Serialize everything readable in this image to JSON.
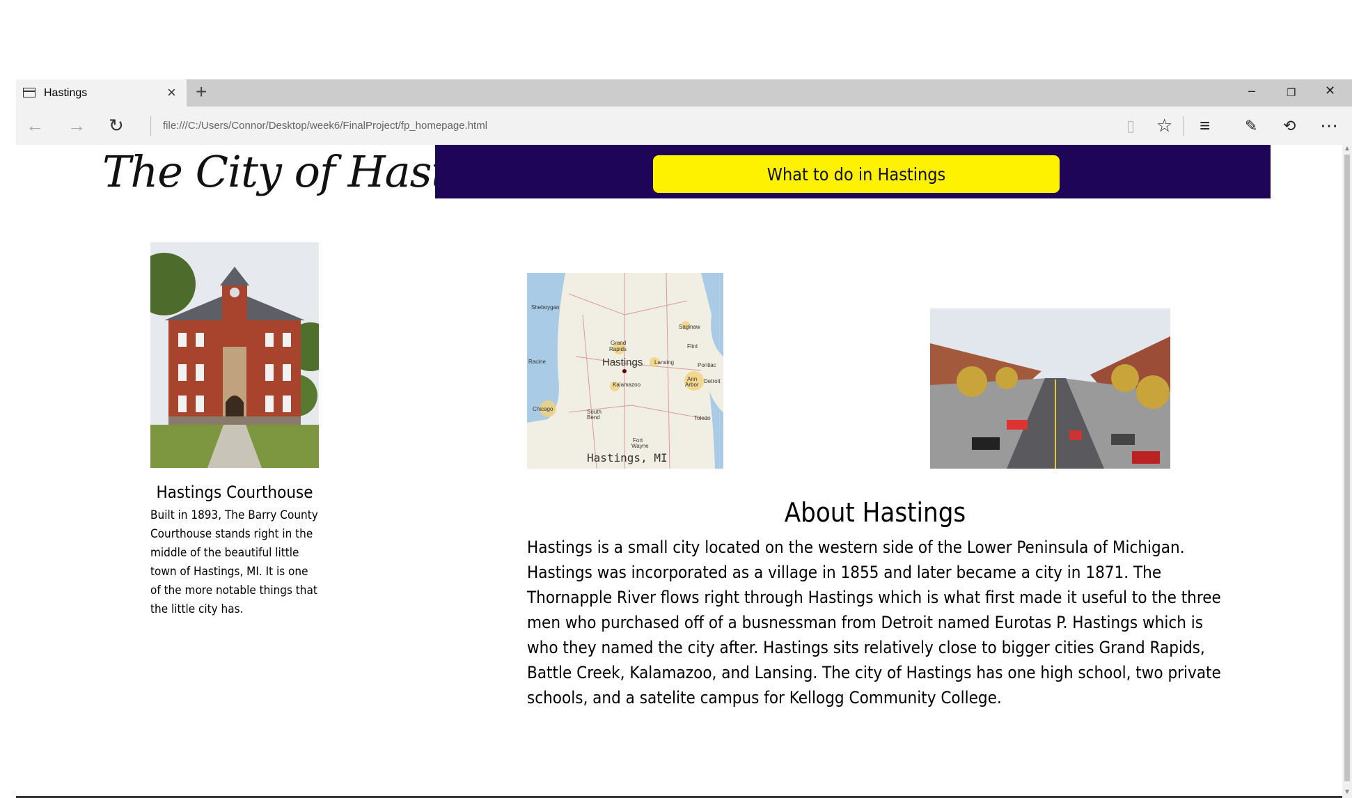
{
  "browser": {
    "tab_title": "Hastings",
    "url": "file:///C:/Users/Connor/Desktop/week6/FinalProject/fp_homepage.html"
  },
  "site": {
    "logo_text": "The City of Hastings",
    "nav_button_label": "What to do in Hastings",
    "colors": {
      "nav_band": "#1e0557",
      "nav_button": "#fff200"
    }
  },
  "courthouse": {
    "title": "Hastings Courthouse",
    "body": "Built in 1893, The Barry County Courthouse stands right in the middle of the beautiful little town of Hastings, MI. It is one of the more notable things that the little city has."
  },
  "map": {
    "caption": "Hastings, MI",
    "labels": {
      "hastings": "Hastings",
      "sheboygan": "Sheboygan",
      "saginaw": "Saginaw",
      "grand_rapids_1": "Grand",
      "grand_rapids_2": "Rapids",
      "flint": "Flint",
      "racine": "Racine",
      "lansing": "Lansing",
      "pontiac": "Pontiac",
      "ann_arbor_1": "Ann",
      "ann_arbor_2": "Arbor",
      "detroit": "Detroit",
      "kalamazoo": "Kalamazoo",
      "chicago": "Chicago",
      "south_bend_1": "South",
      "south_bend_2": "Bend",
      "toledo": "Toledo",
      "fort_wayne_1": "Fort",
      "fort_wayne_2": "Wayne"
    }
  },
  "about": {
    "title": "About Hastings",
    "body": "Hastings is a small city located on the western side of the Lower Peninsula of Michigan. Hastings was incorporated as a village in 1855 and later became a city in 1871. The Thornapple River flows right through Hastings which is what first made it useful to the three men who purchased off of a busnessman from Detroit named Eurotas P. Hastings which is who they named the city after. Hastings sits relatively close to bigger cities Grand Rapids, Battle Creek, Kalamazoo, and Lansing. The city of Hastings has one high school, two private schools, and a satelite campus for Kellogg Community College."
  },
  "icons": [
    "page-icon",
    "close-icon",
    "plus-icon",
    "minimize-icon",
    "restore-icon",
    "back-arrow-icon",
    "forward-arrow-icon",
    "refresh-icon",
    "reading-view-icon",
    "star-icon",
    "hub-icon",
    "web-note-icon",
    "share-icon",
    "more-icon"
  ]
}
